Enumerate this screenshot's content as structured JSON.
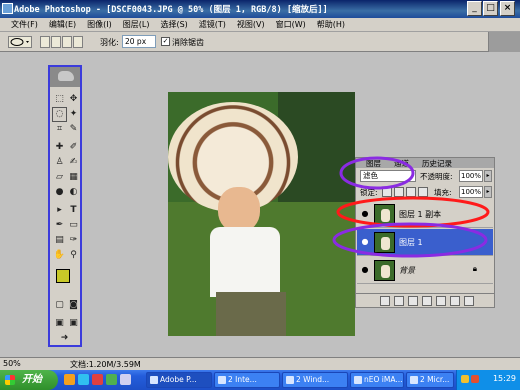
{
  "window": {
    "title": "Adobe Photoshop - [DSCF0043.JPG @ 50% (图层 1, RGB/8) [缩放后]]",
    "controls": [
      "_",
      "□",
      "×"
    ]
  },
  "menu": [
    "文件(F)",
    "编辑(E)",
    "图像(I)",
    "图层(L)",
    "选择(S)",
    "滤镜(T)",
    "视图(V)",
    "窗口(W)",
    "帮助(H)"
  ],
  "options": {
    "feather_label": "羽化:",
    "feather_value": "20 px",
    "antialias_label": "消除锯齿",
    "antialias_checked": true
  },
  "layers_panel": {
    "tabs": [
      "图层",
      "通道",
      "历史记录"
    ],
    "blend_mode": "滤色",
    "opacity_label": "不透明度:",
    "opacity_value": "100%",
    "lock_label": "锁定:",
    "fill_label": "填充:",
    "fill_value": "100%",
    "layers": [
      {
        "name": "图层 1 副本",
        "visible": true,
        "selected": false
      },
      {
        "name": "图层 1",
        "visible": true,
        "selected": true
      },
      {
        "name": "背景",
        "visible": true,
        "selected": false,
        "locked": true
      }
    ]
  },
  "status": {
    "zoom": "50%",
    "doc": "文档:1.20M/3.59M"
  },
  "taskbar": {
    "start": "开始",
    "tasks": [
      "Adobe P...",
      "2 Inte...",
      "2 Wind...",
      "nEO iMA...",
      "2 Micr..."
    ],
    "clock": "15:29"
  },
  "colors": {
    "accent": "#3a5fcd",
    "annotation_red": "#ff1a1a",
    "annotation_purple": "#8a2be2",
    "foreground_swatch": "#c8c828",
    "background_swatch": "#000000"
  }
}
